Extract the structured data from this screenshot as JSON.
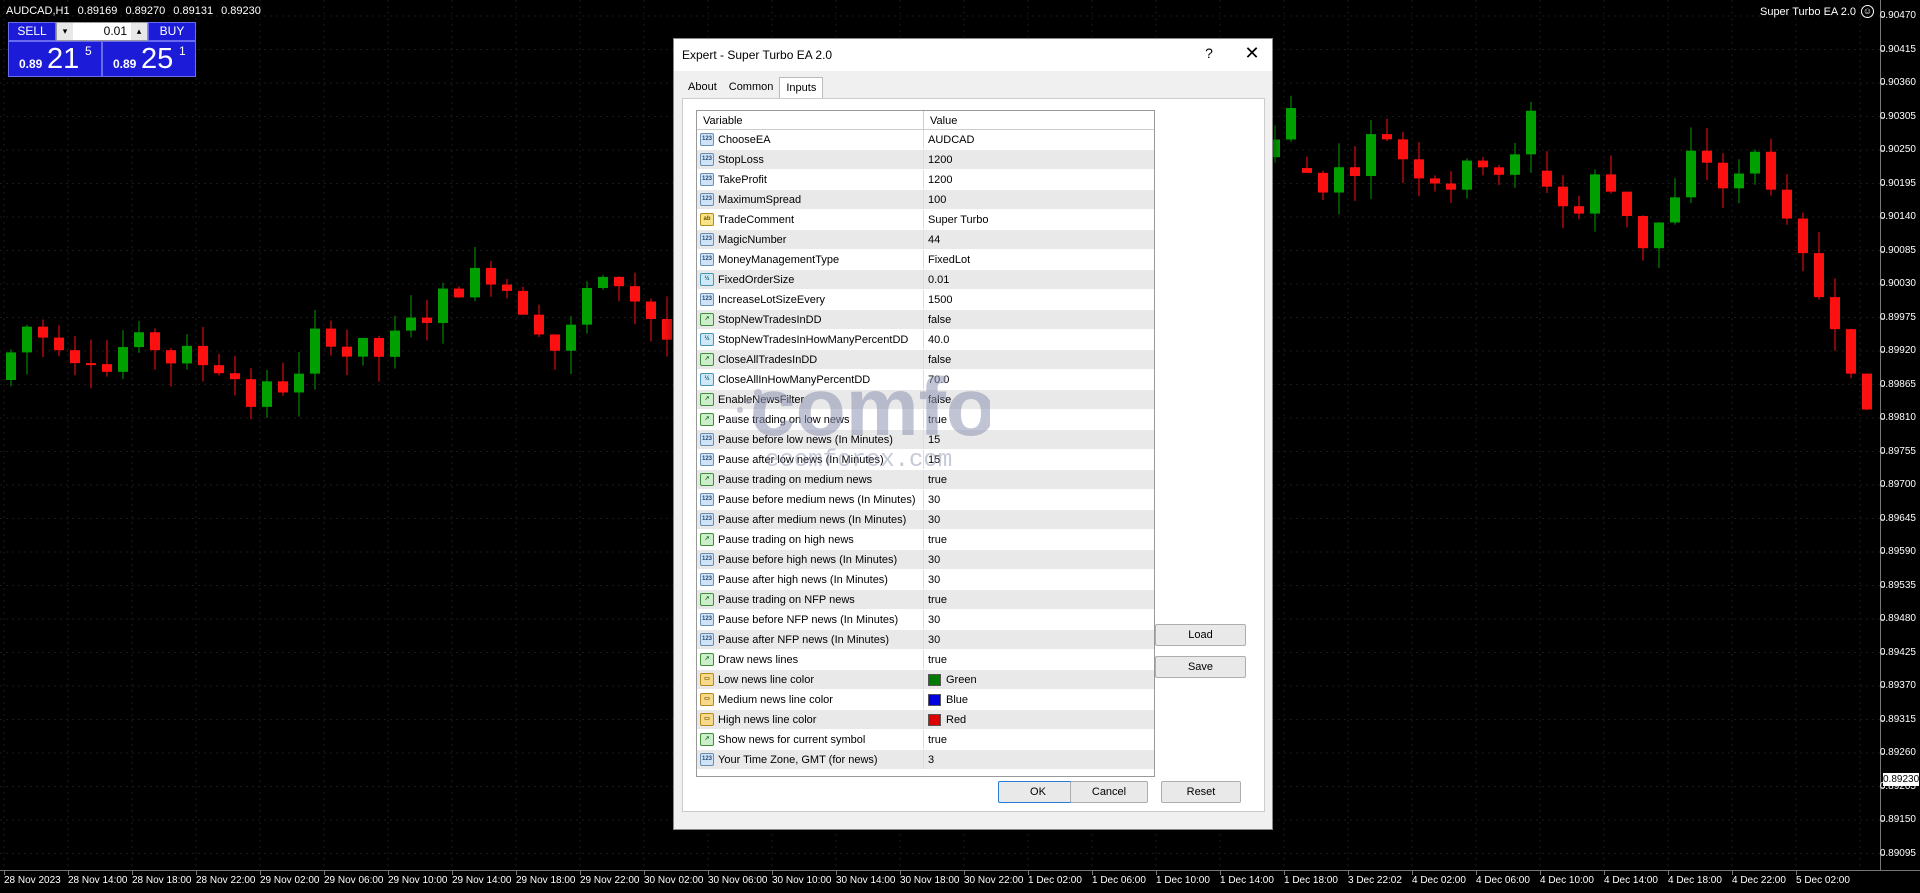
{
  "chart": {
    "symbol_info": "AUDCAD,H1",
    "ohlc": [
      "0.89169",
      "0.89270",
      "0.89131",
      "0.89230"
    ],
    "ea_name": "Super Turbo EA 2.0",
    "ea_face": "☺",
    "current_price": "0.89230",
    "price_labels": [
      "0.90470",
      "0.90415",
      "0.90360",
      "0.90305",
      "0.90250",
      "0.90195",
      "0.90140",
      "0.90085",
      "0.90030",
      "0.89975",
      "0.89920",
      "0.89865",
      "0.89810",
      "0.89755",
      "0.89700",
      "0.89645",
      "0.89590",
      "0.89535",
      "0.89480",
      "0.89425",
      "0.89370",
      "0.89315",
      "0.89260",
      "0.89205",
      "0.89150",
      "0.89095"
    ],
    "time_labels": [
      "28 Nov 2023",
      "28 Nov 14:00",
      "28 Nov 18:00",
      "28 Nov 22:00",
      "29 Nov 02:00",
      "29 Nov 06:00",
      "29 Nov 10:00",
      "29 Nov 14:00",
      "29 Nov 18:00",
      "29 Nov 22:00",
      "30 Nov 02:00",
      "30 Nov 06:00",
      "30 Nov 10:00",
      "30 Nov 14:00",
      "30 Nov 18:00",
      "30 Nov 22:00",
      "1 Dec 02:00",
      "1 Dec 06:00",
      "1 Dec 10:00",
      "1 Dec 14:00",
      "1 Dec 18:00",
      "3 Dec 22:02",
      "4 Dec 02:00",
      "4 Dec 06:00",
      "4 Dec 10:00",
      "4 Dec 14:00",
      "4 Dec 18:00",
      "4 Dec 22:00",
      "5 Dec 02:00"
    ],
    "up_color": "#00a000",
    "down_color": "#ff1010",
    "grid_color": "#1a1a1a"
  },
  "trade_panel": {
    "sell_label": "SELL",
    "buy_label": "BUY",
    "lot": "0.01",
    "step_down": "▾",
    "step_up": "▴",
    "sell_prefix": "0.89",
    "sell_big": "21",
    "sell_sup": "5",
    "buy_prefix": "0.89",
    "buy_big": "25",
    "buy_sup": "1"
  },
  "watermark": {
    "logo_text": "comforex",
    "domain_text": "ecomforex.com"
  },
  "dialog": {
    "title": "Expert - Super Turbo EA 2.0",
    "help": "?",
    "close": "✕",
    "tabs": [
      "About",
      "Common",
      "Inputs"
    ],
    "active_tab": "Inputs",
    "col_variable": "Variable",
    "col_value": "Value",
    "params": [
      {
        "icon": "int",
        "name": "ChooseEA",
        "value": "AUDCAD"
      },
      {
        "icon": "int",
        "name": "StopLoss",
        "value": "1200"
      },
      {
        "icon": "int",
        "name": "TakeProfit",
        "value": "1200"
      },
      {
        "icon": "int",
        "name": "MaximumSpread",
        "value": "100"
      },
      {
        "icon": "str",
        "name": "TradeComment",
        "value": "Super Turbo"
      },
      {
        "icon": "int",
        "name": "MagicNumber",
        "value": "44"
      },
      {
        "icon": "int",
        "name": "MoneyManagementType",
        "value": "FixedLot"
      },
      {
        "icon": "dbl",
        "name": "FixedOrderSize",
        "value": "0.01"
      },
      {
        "icon": "int",
        "name": "IncreaseLotSizeEvery",
        "value": "1500"
      },
      {
        "icon": "bool",
        "name": "StopNewTradesInDD",
        "value": "false"
      },
      {
        "icon": "dbl",
        "name": "StopNewTradesInHowManyPercentDD",
        "value": "40.0"
      },
      {
        "icon": "bool",
        "name": "CloseAllTradesInDD",
        "value": "false"
      },
      {
        "icon": "dbl",
        "name": "CloseAllInHowManyPercentDD",
        "value": "70.0"
      },
      {
        "icon": "bool",
        "name": "EnableNewsFilter",
        "value": "false"
      },
      {
        "icon": "bool",
        "name": "Pause trading on low news",
        "value": "true"
      },
      {
        "icon": "int",
        "name": "Pause before low news (In Minutes)",
        "value": "15"
      },
      {
        "icon": "int",
        "name": "Pause after low news (In Minutes)",
        "value": "15"
      },
      {
        "icon": "bool",
        "name": "Pause trading on medium news",
        "value": "true"
      },
      {
        "icon": "int",
        "name": "Pause before medium news (In Minutes)",
        "value": "30"
      },
      {
        "icon": "int",
        "name": "Pause after medium news (In Minutes)",
        "value": "30"
      },
      {
        "icon": "bool",
        "name": "Pause trading on high news",
        "value": "true"
      },
      {
        "icon": "int",
        "name": "Pause before high news (In Minutes)",
        "value": "30"
      },
      {
        "icon": "int",
        "name": "Pause after high news (In Minutes)",
        "value": "30"
      },
      {
        "icon": "bool",
        "name": "Pause trading on NFP news",
        "value": "true"
      },
      {
        "icon": "int",
        "name": "Pause before NFP news (In Minutes)",
        "value": "30"
      },
      {
        "icon": "int",
        "name": "Pause after NFP news (In Minutes)",
        "value": "30"
      },
      {
        "icon": "bool",
        "name": "Draw news lines",
        "value": "true"
      },
      {
        "icon": "col",
        "name": "Low news line color",
        "value": "Green",
        "swatch": "#007a00"
      },
      {
        "icon": "col",
        "name": "Medium news line color",
        "value": "Blue",
        "swatch": "#0000e0"
      },
      {
        "icon": "col",
        "name": "High news line color",
        "value": "Red",
        "swatch": "#e00000"
      },
      {
        "icon": "bool",
        "name": "Show news for current symbol",
        "value": "true"
      },
      {
        "icon": "int",
        "name": "Your Time Zone, GMT (for news)",
        "value": "3"
      }
    ],
    "icon_labels": {
      "int": "123",
      "str": "ab",
      "bool": "↗",
      "dbl": "½",
      "col": "▭"
    },
    "buttons": {
      "load": "Load",
      "save": "Save",
      "ok": "OK",
      "cancel": "Cancel",
      "reset": "Reset"
    }
  }
}
